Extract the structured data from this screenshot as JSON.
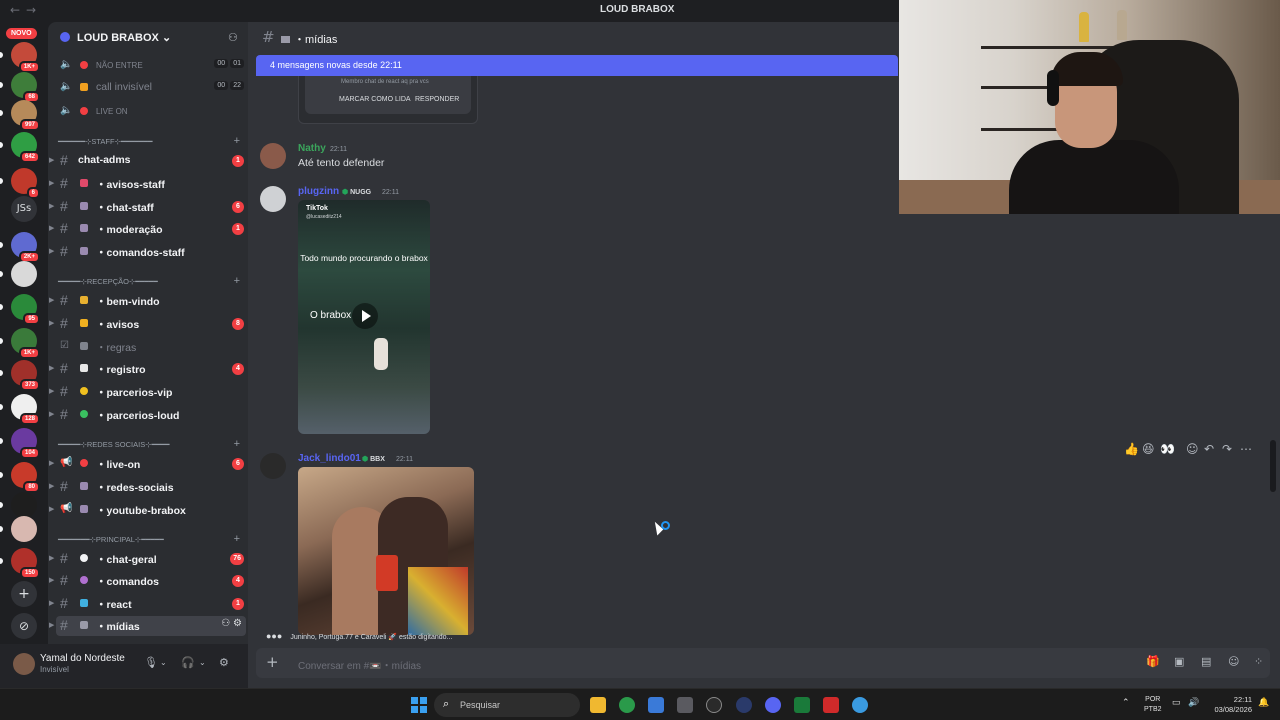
{
  "window": {
    "title": "LOUD BRABOX"
  },
  "rail": {
    "novo": "NOVO",
    "js_label": "JSs",
    "servers": [
      {
        "badge": "1K+",
        "color": "#c44a3a"
      },
      {
        "badge": "68",
        "color": "#3e7d3a"
      },
      {
        "badge": "997",
        "color": "#b68a5a"
      },
      {
        "badge": "642",
        "color": "#2f9e44"
      },
      {
        "badge": "6",
        "color": "#c0392b"
      },
      {
        "badge": "2K+",
        "color": "#5f6ad1"
      },
      {
        "badge": "",
        "color": "#d9d9d9"
      },
      {
        "badge": "95",
        "color": "#2a8a3a"
      },
      {
        "badge": "1K+",
        "color": "#3a7a3a"
      },
      {
        "badge": "373",
        "color": "#a0302a"
      },
      {
        "badge": "128",
        "color": "#efefef"
      },
      {
        "badge": "104",
        "color": "#6a3aa0"
      },
      {
        "badge": "80",
        "color": "#c83a2a"
      },
      {
        "badge": "",
        "color": "#1e1e1e"
      },
      {
        "badge": "",
        "color": "#d8b8b0"
      },
      {
        "badge": "150",
        "color": "#b0302a"
      }
    ]
  },
  "guild": {
    "name": "LOUD BRABOX"
  },
  "voice": [
    {
      "name": "NÃO ENTRE",
      "c1": "00",
      "c2": "01"
    },
    {
      "name": "call invisível",
      "c1": "00",
      "c2": "22"
    },
    {
      "name": "LIVE ON"
    }
  ],
  "categories": {
    "staff": "━━━━━━⊹STAFF⊹━━━━━━━",
    "recepcao": "━━━━━⊹RECEPÇÃO⊹━━━━━",
    "redes": "━━━━━⊹REDES SOCIAIS⊹━━━━",
    "principal": "━━━━━━━⊹PRINCIPAL⊹━━━━━"
  },
  "channels": {
    "chat_adms": {
      "name": "chat-adms",
      "badge": "1"
    },
    "avisos_staff": {
      "name": "・avisos-staff"
    },
    "chat_staff": {
      "name": "・chat-staff",
      "badge": "6"
    },
    "moderacao": {
      "name": "・moderação",
      "badge": "1"
    },
    "comandos_staff": {
      "name": "・comandos-staff"
    },
    "bem_vindo": {
      "name": "・bem-vindo"
    },
    "avisos": {
      "name": "・avisos",
      "badge": "8"
    },
    "regras": {
      "name": "・regras"
    },
    "registro": {
      "name": "・registro",
      "badge": "4"
    },
    "parcerios_vip": {
      "name": "・parcerios-vip"
    },
    "parcerios_loud": {
      "name": "・parcerios-loud"
    },
    "live_on": {
      "name": "・live-on",
      "badge": "6"
    },
    "redes_sociais": {
      "name": "・redes-sociais"
    },
    "youtube_brabox": {
      "name": "・youtube-brabox"
    },
    "chat_geral": {
      "name": "・chat-geral",
      "badge": "76"
    },
    "comandos": {
      "name": "・comandos",
      "badge": "4"
    },
    "react": {
      "name": "・react",
      "badge": "1"
    },
    "midias": {
      "name": "・mídias"
    }
  },
  "user": {
    "name": "Yamal do Nordeste",
    "status": "Invisível"
  },
  "header": {
    "channel": "・mídias"
  },
  "new_messages": "4 mensagens novas desde 22:11",
  "embed": {
    "member_text": "Membro chat de react aq pra vcs",
    "mark_read": "MARCAR COMO LIDA",
    "reply": "RESPONDER"
  },
  "messages": [
    {
      "author": "Nathy",
      "color": "#3ba55c",
      "time": "22:11",
      "text": "Até tento defender"
    },
    {
      "author": "plugzinn",
      "color": "#5865f2",
      "tag": "NUGG",
      "time": "22:11"
    },
    {
      "author": "Jack_lindo01",
      "color": "#5865f2",
      "tag": "BBX",
      "time": "22:11"
    }
  ],
  "video": {
    "brand": "TikTok",
    "handle": "@lucaseditz214",
    "caption": "Todo mundo procurando o brabox",
    "caption2": "O brabox"
  },
  "typing": "Juninho, Portuga.77 e Caraveli 🚀 estão digitando...",
  "composer": {
    "placeholder": "Conversar em #📼・mídias"
  },
  "taskbar": {
    "search": "Pesquisar",
    "lang1": "POR",
    "lang2": "PTB2",
    "time": "22:11",
    "date": "03/08/2026"
  }
}
